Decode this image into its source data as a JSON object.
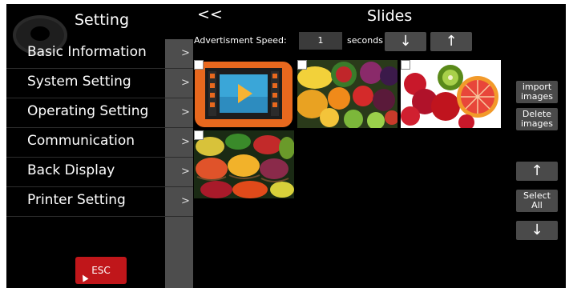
{
  "sidebar": {
    "title": "Setting",
    "items": [
      {
        "label": "Basic Information"
      },
      {
        "label": "System Setting"
      },
      {
        "label": "Operating Setting"
      },
      {
        "label": "Communication"
      },
      {
        "label": "Back Display"
      },
      {
        "label": "Printer Setting"
      }
    ],
    "arrow": ">",
    "esc_label": "ESC"
  },
  "header": {
    "back_label": "<<",
    "title": "Slides"
  },
  "speed": {
    "label": "Advertisment Speed:",
    "value": "1",
    "unit": "seconds",
    "down_label": "↓",
    "up_label": "↑"
  },
  "thumbnails": [
    {
      "icon": "video-file-icon"
    },
    {
      "icon": "fruit-pile-image"
    },
    {
      "icon": "fruit-slices-image"
    },
    {
      "icon": "fruit-baskets-image"
    }
  ],
  "actions": {
    "import_l1": "import",
    "import_l2": "images",
    "delete_l1": "Delete",
    "delete_l2": "images",
    "move_up": "↑",
    "select_l1": "Select",
    "select_l2": "All",
    "move_down": "↓"
  }
}
